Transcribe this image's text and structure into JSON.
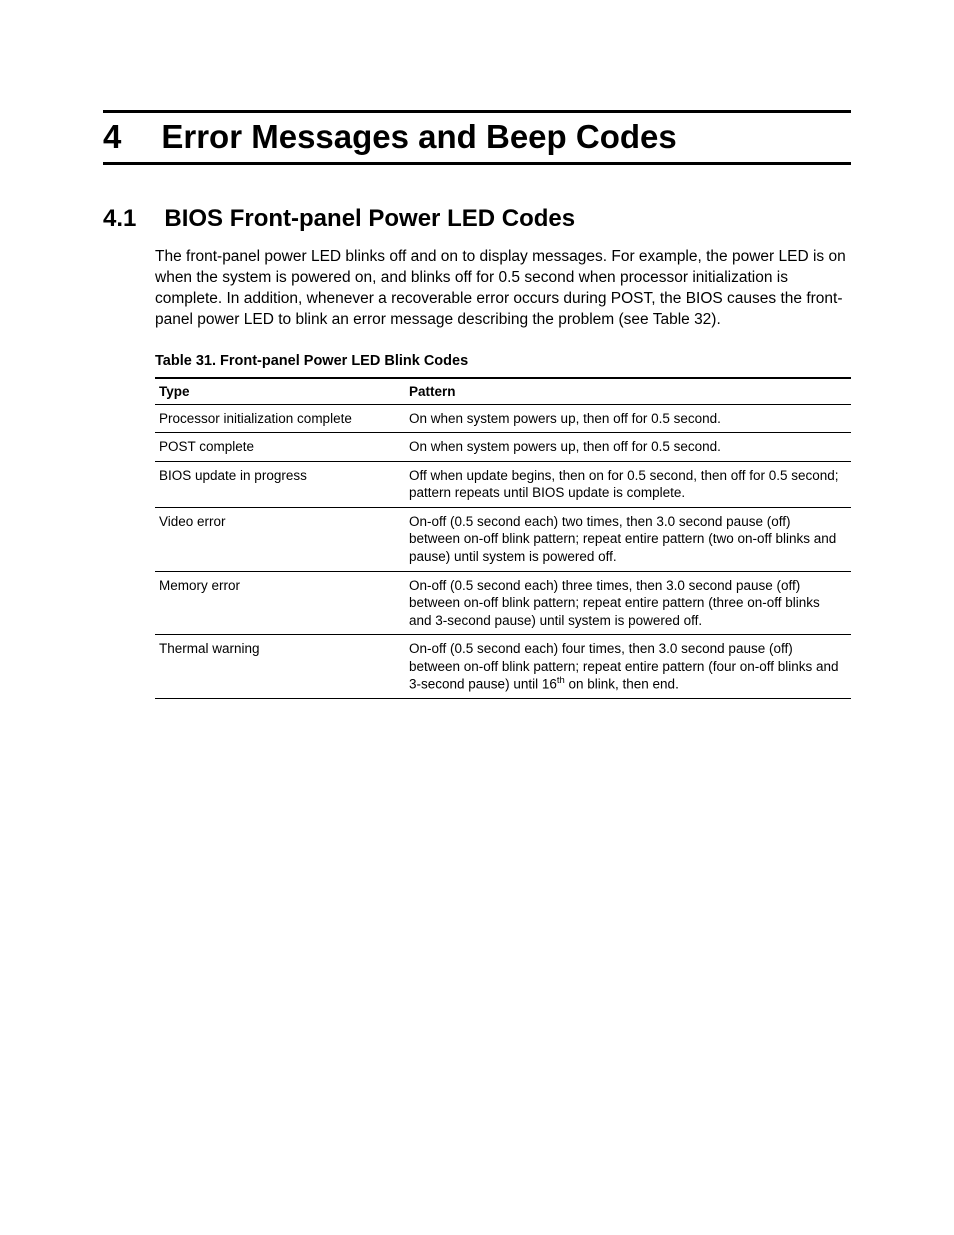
{
  "chapter": {
    "number": "4",
    "title": "Error Messages and Beep Codes"
  },
  "section": {
    "number": "4.1",
    "title": "BIOS Front-panel Power LED Codes"
  },
  "paragraph": "The front-panel power LED blinks off and on to display messages. For example, the power LED is on when the system is powered on, and blinks off for 0.5 second when processor initialization is complete. In addition, whenever a recoverable error occurs during POST, the BIOS causes the front-panel power LED to blink an error message describing the problem (see Table 32).",
  "table": {
    "caption": "Table 31.  Front-panel Power LED Blink Codes",
    "headers": {
      "col1": "Type",
      "col2": "Pattern"
    },
    "rows": [
      {
        "type": "Processor initialization complete",
        "pattern": "On when system powers up, then off for 0.5 second."
      },
      {
        "type": "POST complete",
        "pattern": "On when system powers up, then off for 0.5 second."
      },
      {
        "type": "BIOS update in progress",
        "pattern": "Off when update begins, then on for 0.5 second, then off for 0.5 second; pattern repeats until BIOS update is complete."
      },
      {
        "type": "Video error",
        "pattern": "On-off (0.5 second each) two times, then 3.0 second pause (off) between on-off blink pattern; repeat entire pattern (two on-off blinks and pause) until system is powered off."
      },
      {
        "type": "Memory error",
        "pattern": "On-off (0.5 second each) three times, then 3.0 second pause (off) between on-off blink pattern; repeat entire pattern (three on-off blinks and 3-second pause) until system is powered off."
      },
      {
        "type": "Thermal warning",
        "pattern": "On-off (0.5 second each) four times, then 3.0 second pause (off) between on-off blink pattern; repeat entire pattern (four on-off blinks and 3-second pause) until 16",
        "pattern_sup": "th",
        "pattern_tail": " on blink, then end."
      }
    ]
  }
}
